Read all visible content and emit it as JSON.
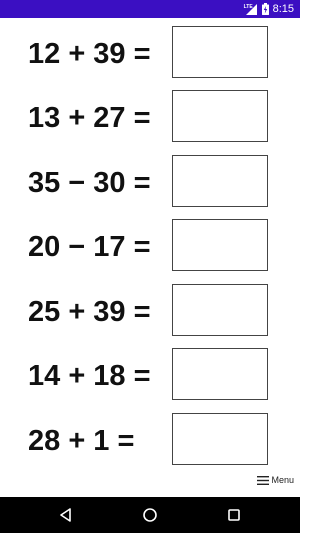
{
  "status_bar": {
    "time": "8:15",
    "network_label": "LTE",
    "background_color": "#3b0fc2",
    "icons": [
      "lte-signal-icon",
      "battery-charging-icon"
    ]
  },
  "problems": [
    {
      "equation": "12 + 39 =",
      "answer": ""
    },
    {
      "equation": "13 + 27 =",
      "answer": ""
    },
    {
      "equation": "35 − 30 =",
      "answer": ""
    },
    {
      "equation": "20 − 17 =",
      "answer": ""
    },
    {
      "equation": "25 + 39 =",
      "answer": ""
    },
    {
      "equation": "14 + 18 =",
      "answer": ""
    },
    {
      "equation": "28 + 1 =",
      "answer": ""
    }
  ],
  "menu": {
    "label": "Menu",
    "icon": "hamburger-menu-icon"
  },
  "nav_bar": {
    "icons": [
      "back-triangle-icon",
      "home-circle-icon",
      "recents-square-icon"
    ]
  }
}
